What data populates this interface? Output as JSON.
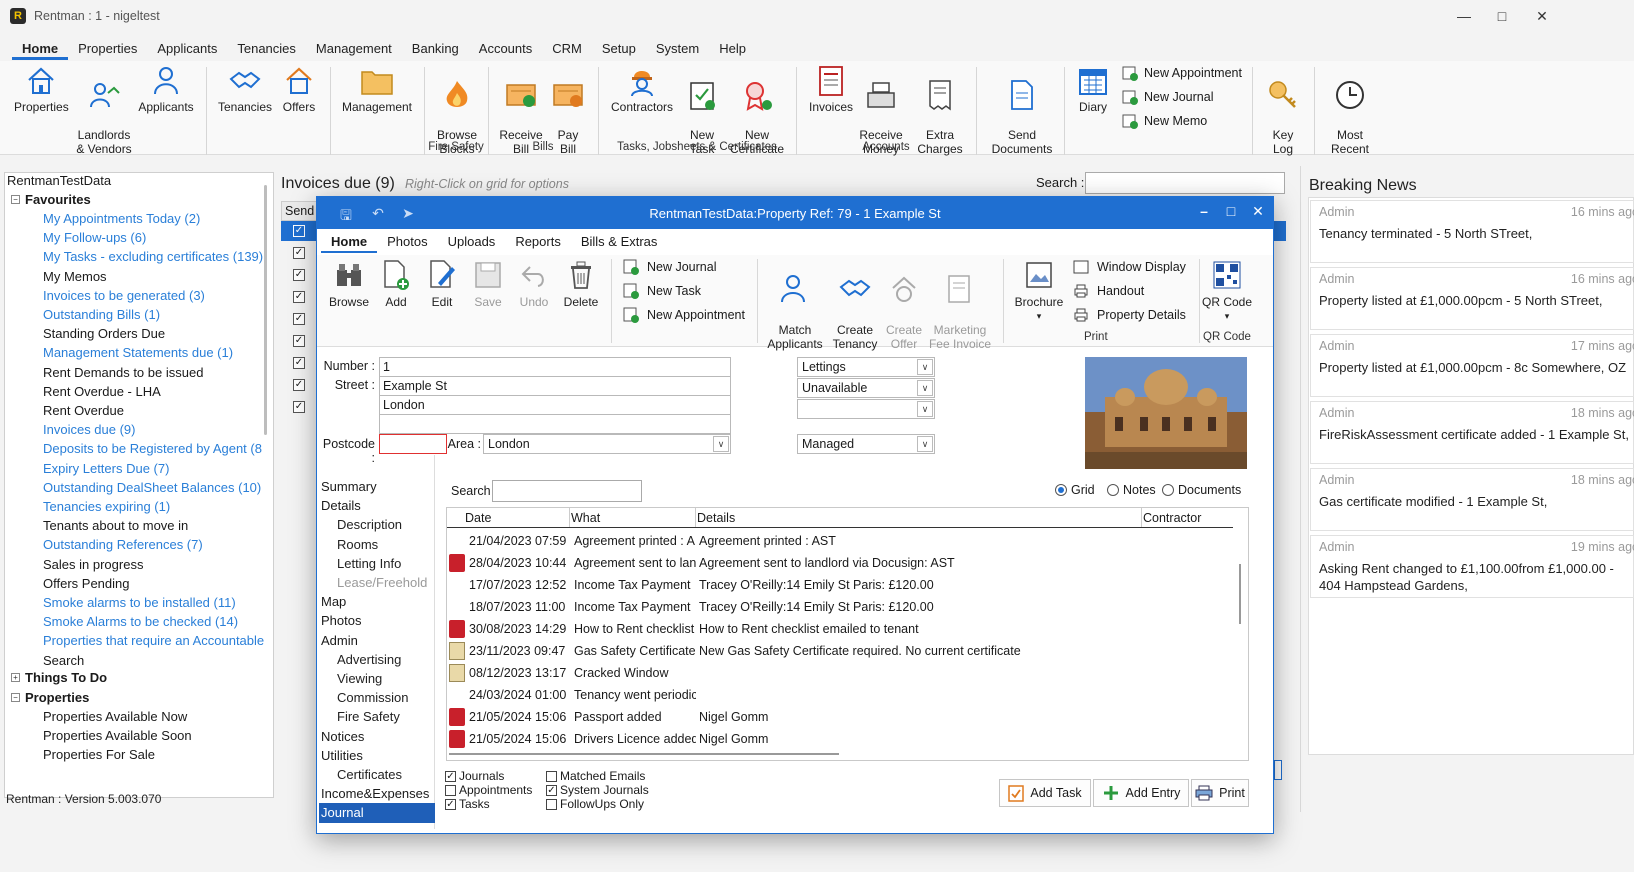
{
  "app": {
    "title": "Rentman : 1 - nigeltest",
    "version": "Rentman : Version  5.003.070"
  },
  "menu": [
    "Home",
    "Properties",
    "Applicants",
    "Tenancies",
    "Management",
    "Banking",
    "Accounts",
    "CRM",
    "Setup",
    "System",
    "Help"
  ],
  "ribbon": {
    "properties": "Properties",
    "landlords": "Landlords\n& Vendors",
    "applicants": "Applicants",
    "tenancies": "Tenancies",
    "offers": "Offers",
    "management": "Management",
    "browse_blocks": "Browse\nBlocks",
    "fire_safety_group": "Fire Safety",
    "receive_bill": "Receive\nBill",
    "pay_bill": "Pay\nBill",
    "bills_group": "Bills",
    "contractors": "Contractors",
    "new_task": "New\nTask",
    "new_certificate": "New\nCertificate",
    "tasks_group": "Tasks, Jobsheets & Certificates",
    "invoices": "Invoices",
    "receive_money": "Receive\nMoney",
    "extra_charges": "Extra\nCharges",
    "accounts_group": "Accounts",
    "send_documents": "Send\nDocuments",
    "diary": "Diary",
    "new_appointment": "New Appointment",
    "new_journal": "New Journal",
    "new_memo": "New Memo",
    "key_log": "Key\nLog",
    "most_recent": "Most\nRecent"
  },
  "tree": {
    "root": "RentmanTestData",
    "favourites": "Favourites",
    "items": [
      {
        "label": "My Appointments Today (2)",
        "link": true
      },
      {
        "label": "My Follow-ups (6)",
        "link": true
      },
      {
        "label": "My Tasks - excluding certificates (139)",
        "link": true
      },
      {
        "label": "My Memos",
        "link": false
      },
      {
        "label": "Invoices to be generated (3)",
        "link": true
      },
      {
        "label": "Outstanding Bills (1)",
        "link": true
      },
      {
        "label": "Standing Orders Due",
        "link": false
      },
      {
        "label": "Management Statements due (1)",
        "link": true
      },
      {
        "label": "Rent Demands to be issued",
        "link": false
      },
      {
        "label": "Rent Overdue - LHA",
        "link": false
      },
      {
        "label": "Rent Overdue",
        "link": false
      },
      {
        "label": "Invoices due (9)",
        "link": true
      },
      {
        "label": "Deposits to be Registered by Agent (8",
        "link": true
      },
      {
        "label": "Expiry Letters Due (7)",
        "link": true
      },
      {
        "label": "Outstanding DealSheet Balances (10)",
        "link": true
      },
      {
        "label": "Tenancies expiring (1)",
        "link": true
      },
      {
        "label": "Tenants about to move in",
        "link": false
      },
      {
        "label": "Outstanding References (7)",
        "link": true
      },
      {
        "label": "Sales in progress",
        "link": false
      },
      {
        "label": "Offers Pending",
        "link": false
      },
      {
        "label": "Smoke alarms to be installed (11)",
        "link": true
      },
      {
        "label": "Smoke Alarms to be checked (14)",
        "link": true
      },
      {
        "label": "Properties that require an Accountable",
        "link": true
      },
      {
        "label": "Search",
        "link": false
      }
    ],
    "things_to_do": "Things To Do",
    "properties": "Properties",
    "property_items": [
      "Properties Available Now",
      "Properties Available Soon",
      "Properties For Sale"
    ]
  },
  "invoices": {
    "title": "Invoices due (9)",
    "hint": "Right-Click on grid for options",
    "search_label": "Search :",
    "column_send": "Send"
  },
  "news": {
    "title": "Breaking News",
    "items": [
      {
        "author": "Admin",
        "time": "16 mins ago",
        "text": "Tenancy terminated - 5 North STreet,"
      },
      {
        "author": "Admin",
        "time": "16 mins ago",
        "text": "Property listed at £1,000.00pcm - 5 North STreet,"
      },
      {
        "author": "Admin",
        "time": "17 mins ago",
        "text": "Property listed at £1,000.00pcm - 8c Somewhere, OZ"
      },
      {
        "author": "Admin",
        "time": "18 mins ago",
        "text": "FireRiskAssessment certificate added - 1 Example St,"
      },
      {
        "author": "Admin",
        "time": "18 mins ago",
        "text": "Gas certificate modified - 1 Example St,"
      },
      {
        "author": "Admin",
        "time": "19 mins ago",
        "text": "Asking Rent changed to £1,100.00from £1,000.00 - 404 Hampstead Gardens,"
      }
    ]
  },
  "modal": {
    "title": "RentmanTestData:Property Ref: 79 - 1 Example St",
    "tabs": [
      "Home",
      "Photos",
      "Uploads",
      "Reports",
      "Bills & Extras"
    ],
    "browse": "Browse",
    "add": "Add",
    "edit": "Edit",
    "save": "Save",
    "undo": "Undo",
    "delete": "Delete",
    "new_journal": "New Journal",
    "new_task": "New Task",
    "new_appointment": "New Appointment",
    "match_applicants": "Match\nApplicants",
    "create_tenancy": "Create\nTenancy",
    "create_offer": "Create\nOffer",
    "marketing_fee_invoice": "Marketing\nFee Invoice",
    "brochure": "Brochure",
    "window_display": "Window Display",
    "handout": "Handout",
    "property_details": "Property Details",
    "print_group": "Print",
    "qr_code": "QR Code",
    "qr_group": "QR Code",
    "form": {
      "number_label": "Number :",
      "number": "1",
      "street_label": "Street :",
      "street": "Example St",
      "town": "London",
      "line3": "",
      "postcode_label": "Postcode :",
      "postcode": "",
      "area_label": "Area :",
      "area": "London",
      "type": "Lettings",
      "status": "Unavailable",
      "status2": "",
      "management": "Managed"
    },
    "nav": [
      {
        "label": "Summary",
        "level": 0
      },
      {
        "label": "Details",
        "level": 0
      },
      {
        "label": "Description",
        "level": 1
      },
      {
        "label": "Rooms",
        "level": 1
      },
      {
        "label": "Letting Info",
        "level": 1
      },
      {
        "label": "Lease/Freehold",
        "level": 1,
        "disabled": true
      },
      {
        "label": "Map",
        "level": 0
      },
      {
        "label": "Photos",
        "level": 0
      },
      {
        "label": "Admin",
        "level": 0
      },
      {
        "label": "Advertising",
        "level": 1
      },
      {
        "label": "Viewing",
        "level": 1
      },
      {
        "label": "Commission",
        "level": 1
      },
      {
        "label": "Fire Safety",
        "level": 1
      },
      {
        "label": "Notices",
        "level": 0
      },
      {
        "label": "Utilities",
        "level": 0
      },
      {
        "label": "Certificates",
        "level": 1
      },
      {
        "label": "Income&Expenses",
        "level": 0
      },
      {
        "label": "Journal",
        "level": 0,
        "selected": true
      }
    ],
    "grid_search_label": "Search :",
    "view_grid": "Grid",
    "view_notes": "Notes",
    "view_documents": "Documents",
    "columns": [
      "Date",
      "What",
      "Details",
      "Contractor"
    ],
    "rows": [
      {
        "icon": "",
        "date": "21/04/2023 07:59",
        "what": "Agreement printed : A",
        "details": "Agreement printed : AST"
      },
      {
        "icon": "pdf",
        "date": "28/04/2023 10:44",
        "what": "Agreement sent to lan",
        "details": "Agreement sent to landlord via Docusign: AST"
      },
      {
        "icon": "",
        "date": "17/07/2023 12:52",
        "what": "Income Tax Payment",
        "details": "Tracey O'Reilly:14 Emily St Paris:   £120.00"
      },
      {
        "icon": "",
        "date": "18/07/2023 11:00",
        "what": "Income Tax Payment",
        "details": "Tracey O'Reilly:14 Emily St Paris:   £120.00"
      },
      {
        "icon": "pdf",
        "date": "30/08/2023 14:29",
        "what": "How to Rent checklist",
        "details": "How to Rent checklist emailed to tenant"
      },
      {
        "icon": "note",
        "date": "23/11/2023 09:47",
        "what": "Gas Safety Certificate",
        "details": "New Gas Safety Certificate required. No current certificate"
      },
      {
        "icon": "note",
        "date": "08/12/2023 13:17",
        "what": "Cracked Window",
        "details": ""
      },
      {
        "icon": "",
        "date": "24/03/2024 01:00",
        "what": "Tenancy went periodic",
        "details": ""
      },
      {
        "icon": "pdf",
        "date": "21/05/2024 15:06",
        "what": "Passport added",
        "details": "Nigel Gomm"
      },
      {
        "icon": "pdf",
        "date": "21/05/2024 15:06",
        "what": "Drivers Licence added",
        "details": "Nigel Gomm"
      }
    ],
    "filters": [
      {
        "label": "Journals",
        "checked": true
      },
      {
        "label": "Appointments",
        "checked": false
      },
      {
        "label": "Tasks",
        "checked": true
      },
      {
        "label": "Matched Emails",
        "checked": false
      },
      {
        "label": "System Journals",
        "checked": true
      },
      {
        "label": "FollowUps Only",
        "checked": false
      }
    ],
    "add_task": "Add Task",
    "add_entry": "Add Entry",
    "print": "Print"
  }
}
